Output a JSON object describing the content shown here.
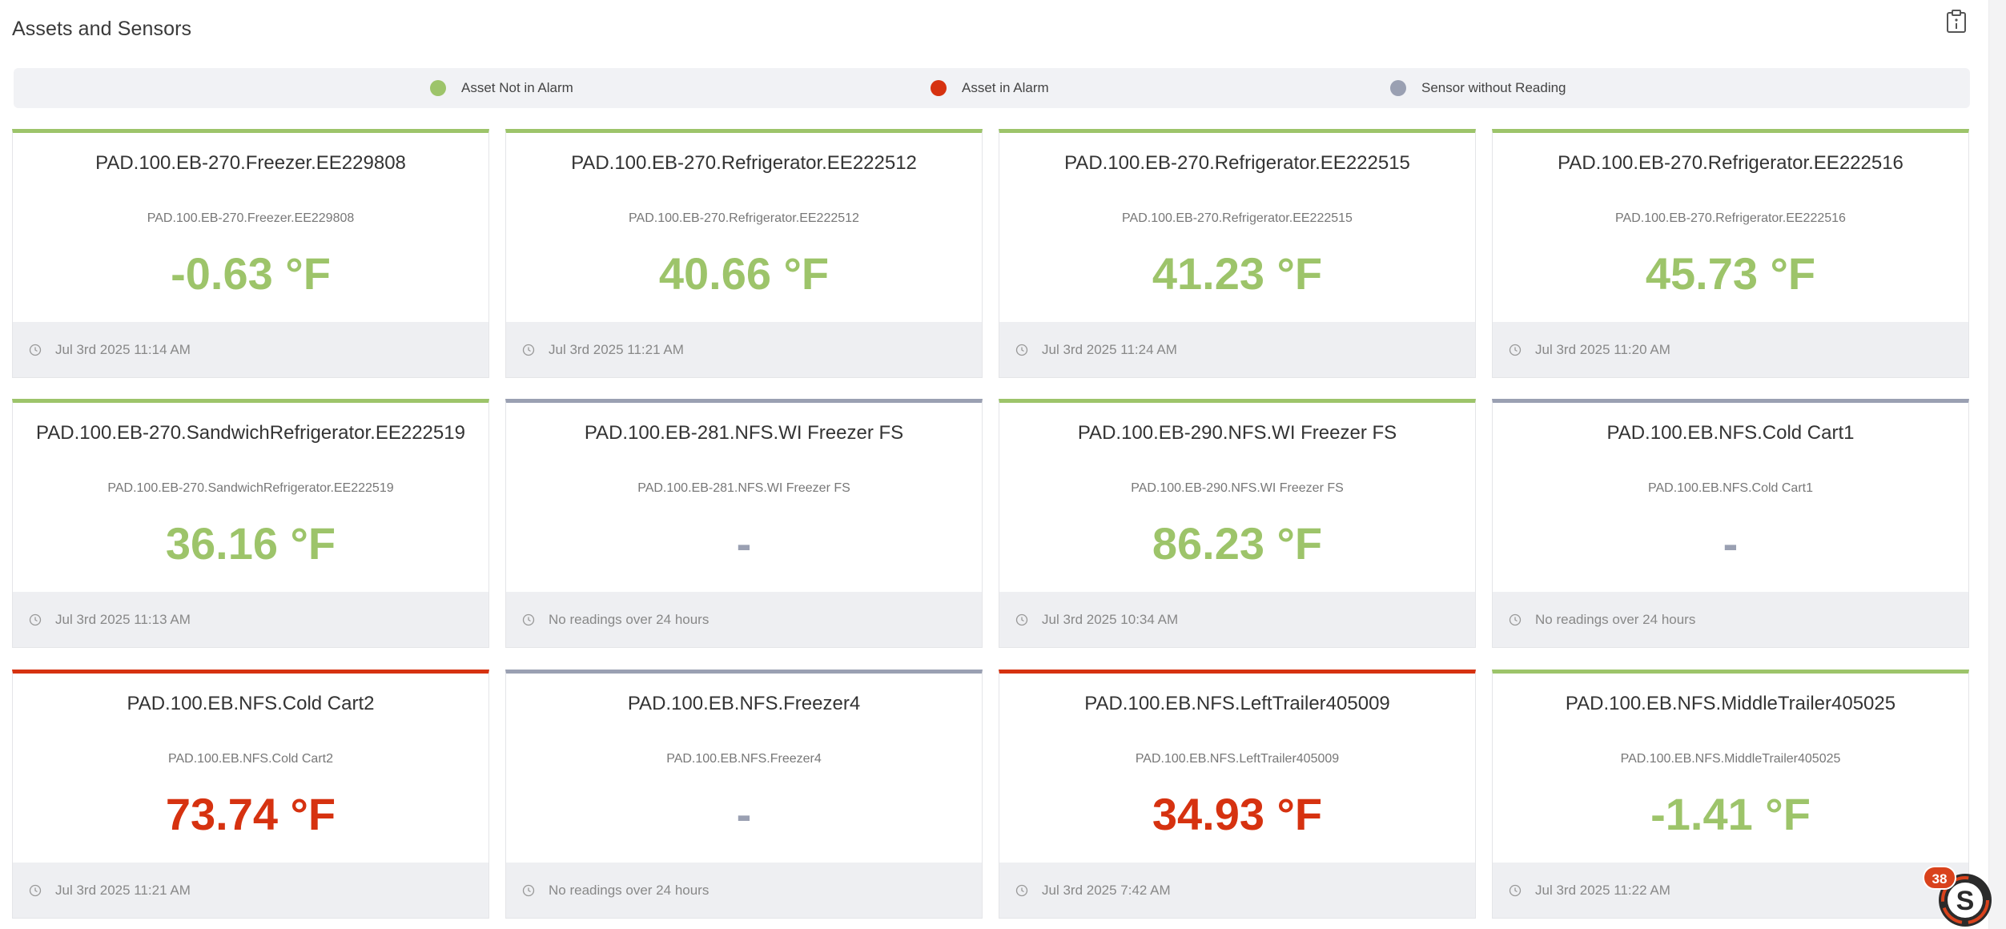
{
  "page": {
    "title": "Assets and Sensors"
  },
  "legend": [
    {
      "label": "Asset Not in Alarm",
      "color": "#9dc46a"
    },
    {
      "label": "Asset in Alarm",
      "color": "#d63210"
    },
    {
      "label": "Sensor without Reading",
      "color": "#9aa0b2"
    }
  ],
  "colors": {
    "ok": "#9dc46a",
    "alarm": "#d63210",
    "none": "#9aa0b2"
  },
  "cards": [
    {
      "name": "PAD.100.EB-270.Freezer.EE229808",
      "sub": "PAD.100.EB-270.Freezer.EE229808",
      "value": "-0.63 °F",
      "time": "Jul 3rd 2025 11:14 AM",
      "status": "ok"
    },
    {
      "name": "PAD.100.EB-270.Refrigerator.EE222512",
      "sub": "PAD.100.EB-270.Refrigerator.EE222512",
      "value": "40.66 °F",
      "time": "Jul 3rd 2025 11:21 AM",
      "status": "ok"
    },
    {
      "name": "PAD.100.EB-270.Refrigerator.EE222515",
      "sub": "PAD.100.EB-270.Refrigerator.EE222515",
      "value": "41.23 °F",
      "time": "Jul 3rd 2025 11:24 AM",
      "status": "ok"
    },
    {
      "name": "PAD.100.EB-270.Refrigerator.EE222516",
      "sub": "PAD.100.EB-270.Refrigerator.EE222516",
      "value": "45.73 °F",
      "time": "Jul 3rd 2025 11:20 AM",
      "status": "ok"
    },
    {
      "name": "PAD.100.EB-270.SandwichRefrigerator.EE222519",
      "sub": "PAD.100.EB-270.SandwichRefrigerator.EE222519",
      "value": "36.16 °F",
      "time": "Jul 3rd 2025 11:13 AM",
      "status": "ok"
    },
    {
      "name": "PAD.100.EB-281.NFS.WI Freezer FS",
      "sub": "PAD.100.EB-281.NFS.WI Freezer FS",
      "value": "-",
      "time": "No readings over 24 hours",
      "status": "none"
    },
    {
      "name": "PAD.100.EB-290.NFS.WI Freezer FS",
      "sub": "PAD.100.EB-290.NFS.WI Freezer FS",
      "value": "86.23 °F",
      "time": "Jul 3rd 2025 10:34 AM",
      "status": "ok"
    },
    {
      "name": "PAD.100.EB.NFS.Cold Cart1",
      "sub": "PAD.100.EB.NFS.Cold Cart1",
      "value": "-",
      "time": "No readings over 24 hours",
      "status": "none"
    },
    {
      "name": "PAD.100.EB.NFS.Cold Cart2",
      "sub": "PAD.100.EB.NFS.Cold Cart2",
      "value": "73.74 °F",
      "time": "Jul 3rd 2025 11:21 AM",
      "status": "alarm"
    },
    {
      "name": "PAD.100.EB.NFS.Freezer4",
      "sub": "PAD.100.EB.NFS.Freezer4",
      "value": "-",
      "time": "No readings over 24 hours",
      "status": "none"
    },
    {
      "name": "PAD.100.EB.NFS.LeftTrailer405009",
      "sub": "PAD.100.EB.NFS.LeftTrailer405009",
      "value": "34.93 °F",
      "time": "Jul 3rd 2025 7:42 AM",
      "status": "alarm"
    },
    {
      "name": "PAD.100.EB.NFS.MiddleTrailer405025",
      "sub": "PAD.100.EB.NFS.MiddleTrailer405025",
      "value": "-1.41 °F",
      "time": "Jul 3rd 2025 11:22 AM",
      "status": "ok"
    }
  ],
  "badge": {
    "count": "38"
  }
}
